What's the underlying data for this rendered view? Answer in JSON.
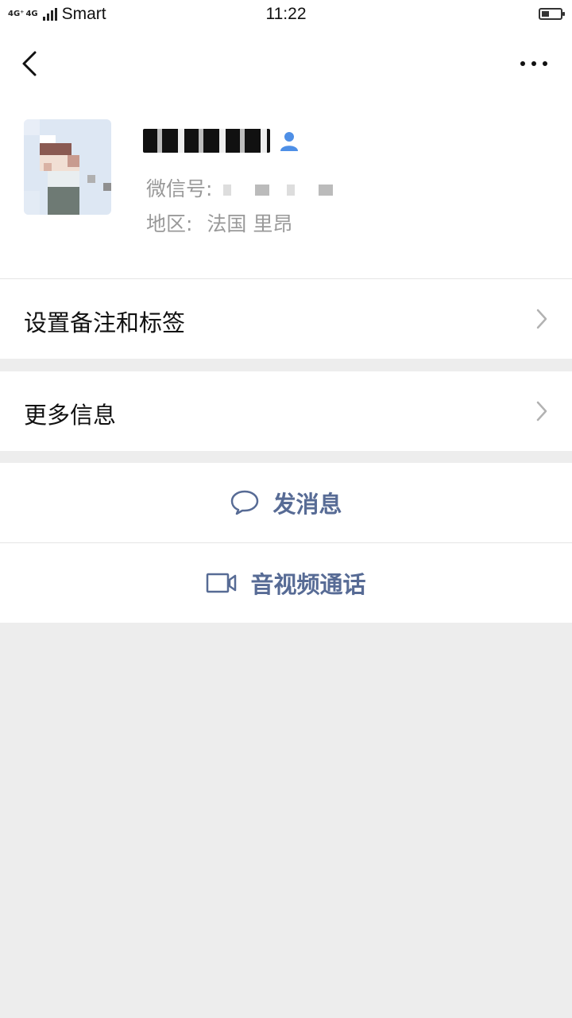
{
  "status_bar": {
    "network1": "4G⁺",
    "network2": "4G",
    "carrier": "Smart",
    "time": "11:22"
  },
  "profile": {
    "id_label": "微信号:",
    "region_label": "地区:",
    "region_value": "法国  里昂"
  },
  "rows": {
    "remark_tags": "设置备注和标签",
    "more_info": "更多信息"
  },
  "actions": {
    "send_message": "发消息",
    "video_call": "音视频通话"
  },
  "colors": {
    "link": "#576b95",
    "background": "#ededed"
  },
  "icons": [
    "back-arrow-icon",
    "more-icon",
    "chevron-right-icon",
    "chat-bubble-icon",
    "video-camera-icon",
    "person-icon"
  ]
}
